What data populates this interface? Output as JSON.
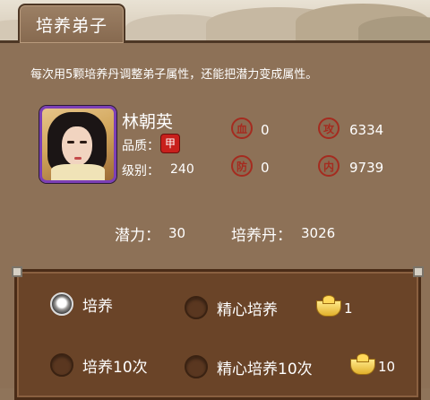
{
  "tab": {
    "title": "培养弟子"
  },
  "description": "每次用5颗培养丹调整弟子属性，还能把潜力变成属性。",
  "disciple": {
    "name": "林朝英",
    "quality_label": "品质：",
    "quality_badge": "甲",
    "level_label": "级别：",
    "level": "240"
  },
  "stats": [
    {
      "icon": "blood-seal-icon",
      "glyph": "血",
      "value": "0"
    },
    {
      "icon": "attack-seal-icon",
      "glyph": "攻",
      "value": "6334"
    },
    {
      "icon": "defense-seal-icon",
      "glyph": "防",
      "value": "0"
    },
    {
      "icon": "inner-seal-icon",
      "glyph": "内",
      "value": "9739"
    }
  ],
  "potential": {
    "label": "潜力：",
    "value": "30"
  },
  "pills": {
    "label": "培养丹：",
    "value": "3026"
  },
  "options": [
    {
      "label": "培养",
      "selected": true
    },
    {
      "label": "精心培养",
      "selected": false,
      "cost": "1"
    },
    {
      "label": "培养10次",
      "selected": false
    },
    {
      "label": "精心培养10次",
      "selected": false,
      "cost": "10"
    }
  ],
  "colors": {
    "seal_red": "#a52b1f",
    "frame_purple": "#7c3fb6",
    "gold": "#e2b12b"
  }
}
